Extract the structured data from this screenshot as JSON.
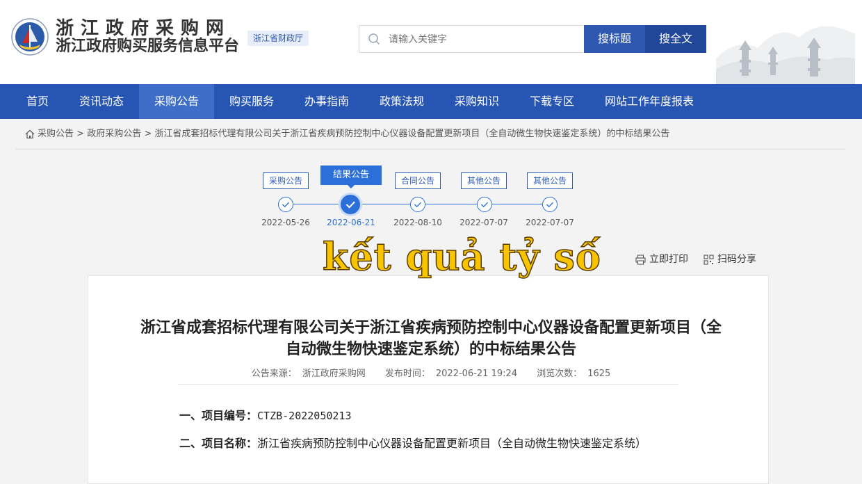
{
  "header": {
    "title_line1": "浙江政府采购网",
    "title_line2": "浙江政府购买服务信息平台",
    "dept_badge": "浙江省财政厅",
    "search_placeholder": "请输入关键字",
    "btn_search_title": "搜标题",
    "btn_search_full": "搜全文"
  },
  "nav": {
    "items": [
      {
        "label": "首页"
      },
      {
        "label": "资讯动态"
      },
      {
        "label": "采购公告",
        "active": true
      },
      {
        "label": "购买服务"
      },
      {
        "label": "办事指南"
      },
      {
        "label": "政策法规"
      },
      {
        "label": "采购知识"
      },
      {
        "label": "下载专区"
      },
      {
        "label": "网站工作年度报表"
      }
    ]
  },
  "breadcrumb": {
    "items": [
      "采购公告",
      "政府采购公告",
      "浙江省成套招标代理有限公司关于浙江省疾病预防控制中心仪器设备配置更新项目（全自动微生物快速鉴定系统）的中标结果公告"
    ],
    "separator": ">"
  },
  "timeline": [
    {
      "label": "采购公告",
      "date": "2022-05-26"
    },
    {
      "label": "结果公告",
      "date": "2022-06-21",
      "active": true
    },
    {
      "label": "合同公告",
      "date": "2022-08-10"
    },
    {
      "label": "其他公告",
      "date": "2022-07-07"
    },
    {
      "label": "其他公告",
      "date": "2022-07-07"
    }
  ],
  "overlay_caption": "kết quả tỷ số",
  "tools": {
    "print": "立即打印",
    "share": "扫码分享"
  },
  "article": {
    "title": "浙江省成套招标代理有限公司关于浙江省疾病预防控制中心仪器设备配置更新项目（全自动微生物快速鉴定系统）的中标结果公告",
    "source_label": "公告来源：",
    "source": "浙江政府采购网",
    "publish_label": "发布时间：",
    "publish_time": "2022-06-21 19:24",
    "views_label": "浏览次数：",
    "views": "1625",
    "item1_label": "一、项目编号：",
    "item1_value": "CTZB-2022050213",
    "item2_label": "二、项目名称：",
    "item2_value": "浙江省疾病预防控制中心仪器设备配置更新项目（全自动微生物快速鉴定系统）"
  },
  "colors": {
    "nav_bg": "#2755b3",
    "nav_active": "#3e6ec7",
    "accent": "#2d6fd8",
    "overlay_fill": "#f7c400"
  }
}
